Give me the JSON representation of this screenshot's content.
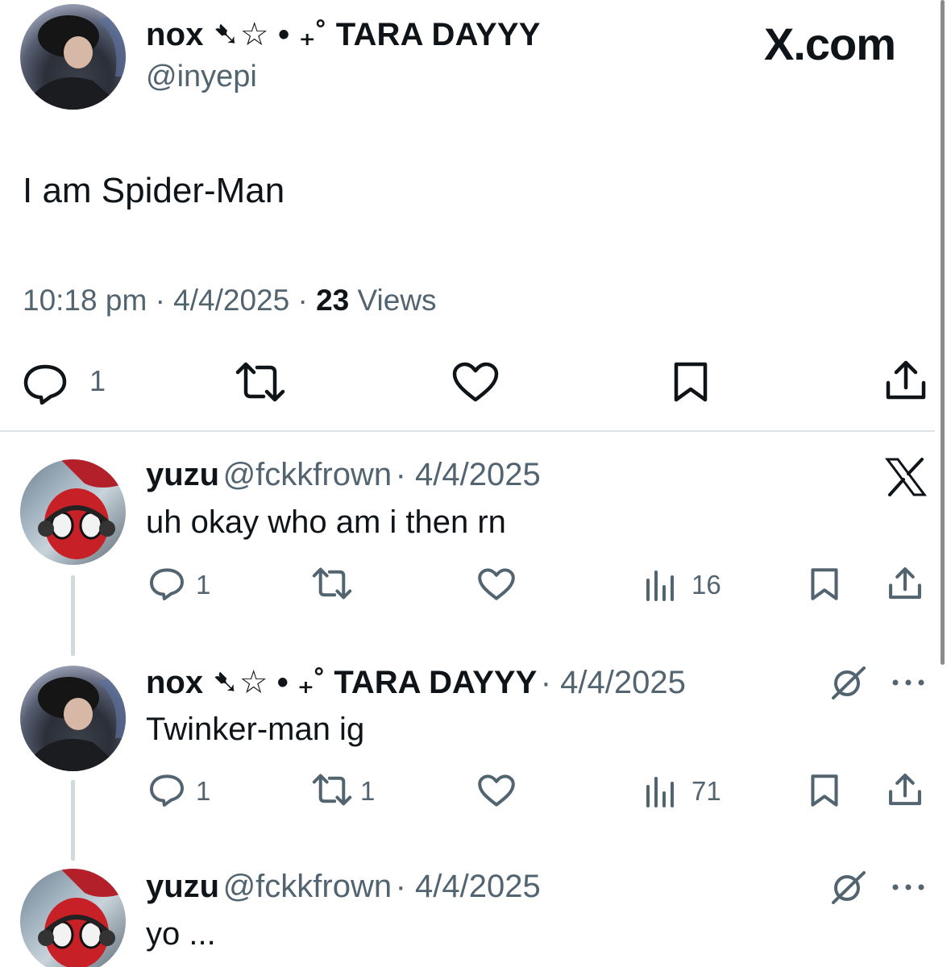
{
  "header": {
    "display_name": "nox ➷☆ • ₊˚ TARA DAYYY",
    "handle": "@inyepi",
    "brand": "X.com"
  },
  "tweet": {
    "text": "I am Spider-Man",
    "time": "10:18 pm",
    "date": "4/4/2025",
    "views_count": "23",
    "views_label": "Views",
    "reply_count": "1"
  },
  "replies": [
    {
      "name": "yuzu",
      "handle": "@fckkfrown",
      "date": "· 4/4/2025",
      "text": "uh okay who am i then rn",
      "reply_count": "1",
      "repost_count": "",
      "views": "16",
      "corner_icon": "x-logo-icon"
    },
    {
      "name": "nox ➷☆ • ₊˚ TARA DAYYY",
      "handle": "",
      "date": "· 4/4/2025",
      "text": "Twinker-man ig",
      "reply_count": "1",
      "repost_count": "1",
      "views": "71",
      "corner_icon": "grok-icon"
    },
    {
      "name": "yuzu",
      "handle": "@fckkfrown",
      "date": "· 4/4/2025",
      "text": "yo ...",
      "corner_icon": "grok-icon"
    }
  ],
  "colors": {
    "text": "#0f1419",
    "secondary": "#536471",
    "divider": "#dfe3e6",
    "thread_line": "#cfd9de"
  }
}
